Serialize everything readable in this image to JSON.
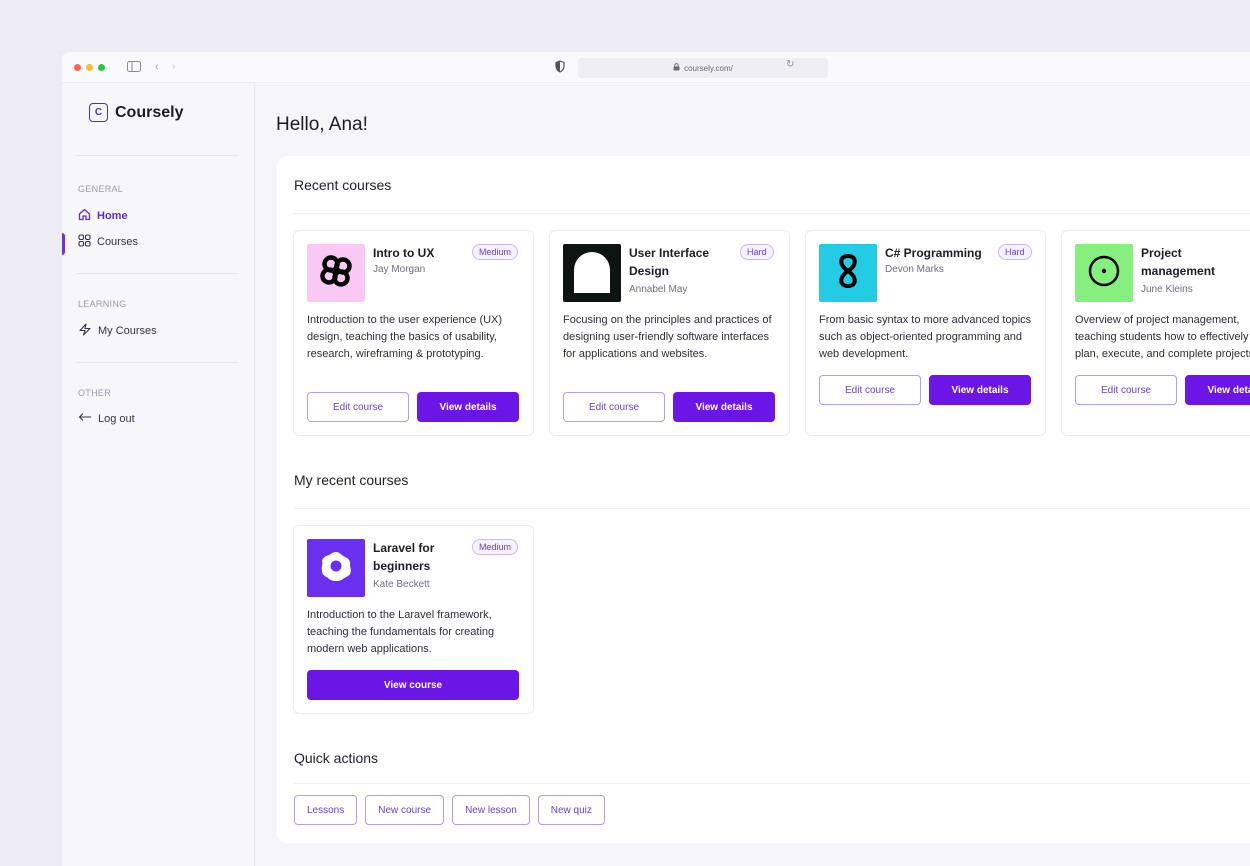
{
  "browser": {
    "url": "coursely.com/"
  },
  "sidebar": {
    "brand_letter": "C",
    "brand_name": "Coursely",
    "sections": [
      {
        "label": "GENERAL",
        "items": [
          {
            "label": "Home",
            "icon": "home-icon"
          },
          {
            "label": "Courses",
            "icon": "grid-icon"
          }
        ]
      },
      {
        "label": "LEARNING",
        "items": [
          {
            "label": "My Courses",
            "icon": "bolt-icon"
          }
        ]
      },
      {
        "label": "OTHER",
        "items": [
          {
            "label": "Log out",
            "icon": "arrow-left-icon"
          }
        ]
      }
    ]
  },
  "main": {
    "greeting": "Hello, Ana!",
    "recent_title": "Recent courses",
    "my_recent_title": "My recent courses",
    "quick_title": "Quick actions",
    "recent_courses": [
      {
        "title": "Intro to UX",
        "author": "Jay Morgan",
        "difficulty": "Medium",
        "description": "Introduction to the user experience (UX) design, teaching the basics of usability, research, wireframing & prototyping.",
        "edit_label": "Edit course",
        "view_label": "View details",
        "thumb_color": "#f9c9f3",
        "icon": "knot-icon"
      },
      {
        "title": "User Interface Design",
        "author": "Annabel May",
        "difficulty": "Hard",
        "description": "Focusing on the principles and practices of designing user-friendly software interfaces for applications and websites.",
        "edit_label": "Edit course",
        "view_label": "View details",
        "thumb_color": "#0e1411",
        "icon": "arch-icon"
      },
      {
        "title": "C# Programming",
        "author": "Devon Marks",
        "difficulty": "Hard",
        "description": "From basic syntax to more advanced topics such as object-oriented programming and web development.",
        "edit_label": "Edit course",
        "view_label": "View details",
        "thumb_color": "#24cbe5",
        "icon": "infinity-icon"
      },
      {
        "title": "Project management",
        "author": "June Kleins",
        "difficulty": "",
        "description": "Overview of project management, teaching students how to effectively plan, execute, and complete projects.",
        "edit_label": "Edit course",
        "view_label": "View details",
        "thumb_color": "#86f07f",
        "icon": "target-icon"
      }
    ],
    "my_recent_courses": [
      {
        "title": "Laravel for beginners",
        "author": "Kate Beckett",
        "difficulty": "Medium",
        "description": "Introduction to the Laravel framework, teaching the fundamentals for creating modern web applications.",
        "action_label": "View course",
        "thumb_color": "#6b2ff0",
        "icon": "flower-icon"
      }
    ],
    "quick_actions": [
      "Lessons",
      "New course",
      "New lesson",
      "New quiz"
    ]
  },
  "colors": {
    "accent": "#6b16e6",
    "badge_text": "#6a3fd8",
    "page_bg": "#edecf5"
  }
}
